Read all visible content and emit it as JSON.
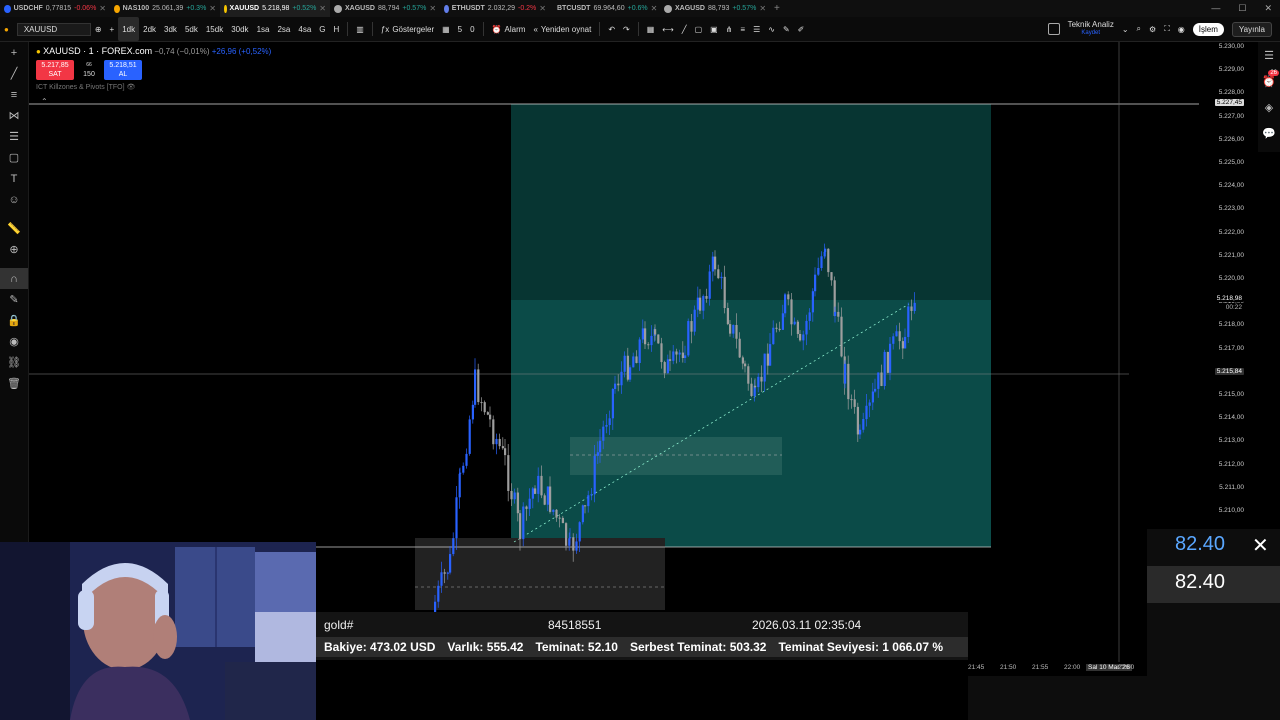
{
  "browser_tabs": [
    {
      "symbol": "USDCHF",
      "price": "0,77815",
      "change": "-0.06%",
      "color": "#2962ff",
      "chg_color": "#f23645",
      "active": false
    },
    {
      "symbol": "NAS100",
      "price": "25.061,39",
      "change": "+0.3%",
      "color": "#f7a600",
      "chg_color": "#26a69a",
      "active": false
    },
    {
      "symbol": "XAUUSD",
      "price": "5.218,98",
      "change": "+0.52%",
      "color": "#f7c600",
      "chg_color": "#26a69a",
      "active": true
    },
    {
      "symbol": "XAGUSD",
      "price": "88,794",
      "change": "+0.57%",
      "color": "#aaaaaa",
      "chg_color": "#26a69a",
      "active": false
    },
    {
      "symbol": "ETHUSDT",
      "price": "2.032,29",
      "change": "-0.2%",
      "color": "#627eea",
      "chg_color": "#f23645",
      "active": false
    },
    {
      "symbol": "BTCUSDT",
      "price": "69.964,60",
      "change": "+0.6%",
      "color": "#f7931a",
      "chg_color": "#26a69a",
      "active": false
    },
    {
      "symbol": "XAGUSD",
      "price": "88,793",
      "change": "+0.57%",
      "color": "#aaaaaa",
      "chg_color": "#26a69a",
      "active": false
    }
  ],
  "toolbar": {
    "symbol": "XAUUSD",
    "timeframes": [
      "1dk",
      "2dk",
      "3dk",
      "5dk",
      "15dk",
      "30dk",
      "1sa",
      "2sa",
      "4sa",
      "G",
      "H"
    ],
    "active_timeframe": "1dk",
    "indicators_label": "Göstergeler",
    "layout_count_1": "5",
    "layout_count_2": "0",
    "alert_label": "Alarm",
    "replay_label": "Yeniden oynat",
    "analysis_label": "Teknik Analiz",
    "analysis_sub": "Kaydet",
    "trade_label": "İşlem",
    "publish_label": "Yayınla"
  },
  "legend": {
    "title": "XAUUSD · 1 · FOREX.com",
    "change": "−0,74 (−0,01%)",
    "change2": "+26,96 (+0,52%)",
    "sell_price": "5.217,85",
    "sell_label": "SAT",
    "spread_top": "66",
    "spread": "150",
    "buy_price": "5.218,51",
    "buy_label": "AL",
    "indicator": "ICT Killzones & Pivots [TFO]"
  },
  "price_axis": [
    "5.230,00",
    "5.229,00",
    "5.228,00",
    "5.227,00",
    "5.226,00",
    "5.225,00",
    "5.224,00",
    "5.223,00",
    "5.222,00",
    "5.221,00",
    "5.220,00",
    "5.219,00",
    "5.218,00",
    "5.217,00",
    "5.216,00",
    "5.215,00",
    "5.214,00",
    "5.213,00",
    "5.212,00",
    "5.211,00",
    "5.210,00"
  ],
  "price_tags": {
    "top_line": "5.227,45",
    "current": "5.218,98",
    "countdown": "00:22",
    "crosshair": "5.215,84"
  },
  "time_axis": [
    "21:45",
    "21:50",
    "21:55",
    "22:00",
    "Sal 10 Mar '26",
    "22:00"
  ],
  "overlay": {
    "account": "gold#",
    "ticket": "84518551",
    "datetime": "2026.03.11 02:35:04",
    "balance": "Bakiye: 473.02 USD",
    "equity": "Varlık: 555.42",
    "margin": "Teminat: 52.10",
    "free_margin": "Serbest Teminat: 503.32",
    "margin_level": "Teminat Seviyesi: 1 066.07 %"
  },
  "right_widget": {
    "value_top": "82.40",
    "value_bottom": "82.40",
    "close": "✕"
  },
  "colors": {
    "bull": "#2962ff",
    "bear": "#9e9e9e",
    "zone_teal": "#0b4b48",
    "zone_teal_light": "#0e5a55",
    "accent_red": "#f23645"
  }
}
